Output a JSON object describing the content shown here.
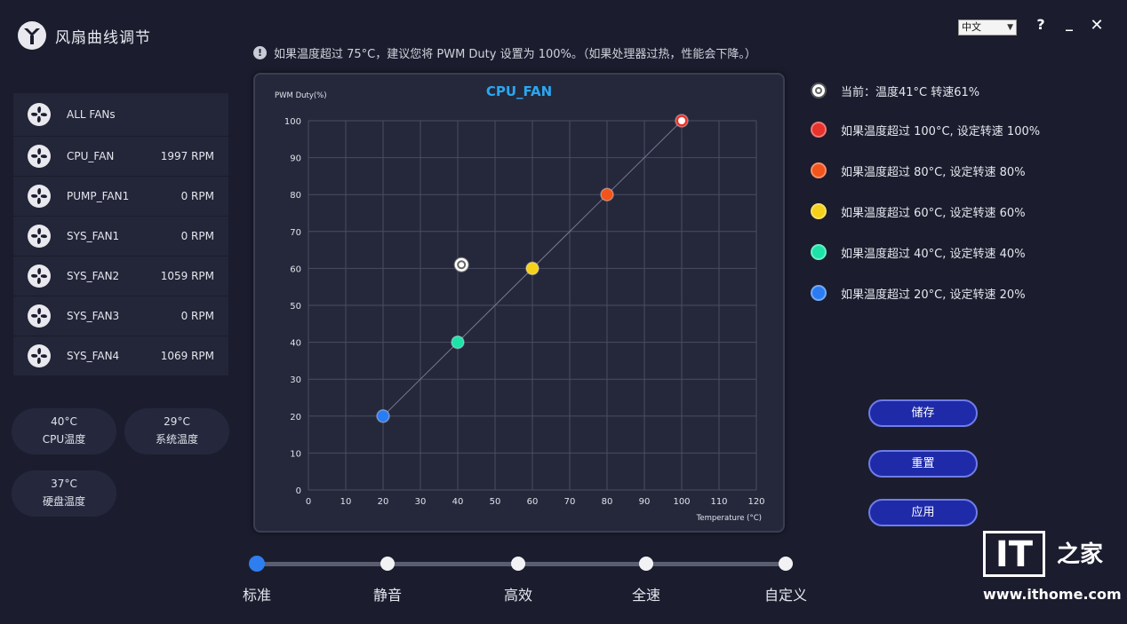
{
  "app": {
    "title": "风扇曲线调节",
    "language": "中文",
    "help_glyph": "?",
    "minimize_glyph": "_",
    "close_glyph": "✕"
  },
  "notice": {
    "icon": "info-icon",
    "text": "如果温度超过 75°C，建议您将 PWM Duty 设置为 100%。（如果处理器过热，性能会下降。）"
  },
  "fans": [
    {
      "name": "ALL FANs",
      "rpm": ""
    },
    {
      "name": "CPU_FAN",
      "rpm": "1997 RPM"
    },
    {
      "name": "PUMP_FAN1",
      "rpm": "0 RPM"
    },
    {
      "name": "SYS_FAN1",
      "rpm": "0 RPM"
    },
    {
      "name": "SYS_FAN2",
      "rpm": "1059 RPM"
    },
    {
      "name": "SYS_FAN3",
      "rpm": "0 RPM"
    },
    {
      "name": "SYS_FAN4",
      "rpm": "1069 RPM"
    }
  ],
  "temps": {
    "cpu": {
      "value": "40°C",
      "label": "CPU温度"
    },
    "system": {
      "value": "29°C",
      "label": "系统温度"
    },
    "disk": {
      "value": "37°C",
      "label": "硬盘温度"
    }
  },
  "chart_data": {
    "type": "line",
    "title": "CPU_FAN",
    "xlabel": "Temperature (°C)",
    "ylabel": "PWM Duty(%)",
    "xlim": [
      0,
      120
    ],
    "ylim": [
      0,
      100
    ],
    "x_ticks": [
      0,
      10,
      20,
      30,
      40,
      50,
      60,
      70,
      80,
      90,
      100,
      110,
      120
    ],
    "y_ticks": [
      0,
      10,
      20,
      30,
      40,
      50,
      60,
      70,
      80,
      90,
      100
    ],
    "grid": true,
    "series": [
      {
        "x": [
          20,
          40,
          60,
          80,
          100
        ],
        "y": [
          20,
          40,
          60,
          80,
          100
        ],
        "colors": [
          "#2a7cf2",
          "#1ee3a8",
          "#f6d11a",
          "#f2541c",
          "#e8322c"
        ]
      }
    ],
    "current_point": {
      "x": 41,
      "y": 61
    }
  },
  "legend": {
    "current": "当前：温度41°C 转速61%",
    "items": [
      {
        "text": "如果温度超过 100°C, 设定转速 100%",
        "color": "#e8322c"
      },
      {
        "text": "如果温度超过 80°C, 设定转速 80%",
        "color": "#f2541c"
      },
      {
        "text": "如果温度超过 60°C, 设定转速 60%",
        "color": "#f6d11a"
      },
      {
        "text": "如果温度超过 40°C, 设定转速 40%",
        "color": "#1ee3a8"
      },
      {
        "text": "如果温度超过 20°C, 设定转速 20%",
        "color": "#2a7cf2"
      }
    ]
  },
  "buttons": {
    "save": "储存",
    "reset": "重置",
    "apply": "应用"
  },
  "profiles": [
    "标准",
    "静音",
    "高效",
    "全速",
    "自定义"
  ],
  "profile_active": "标准",
  "watermark": {
    "logo_text": "IT",
    "char": "之家",
    "url": "www.ithome.com"
  }
}
